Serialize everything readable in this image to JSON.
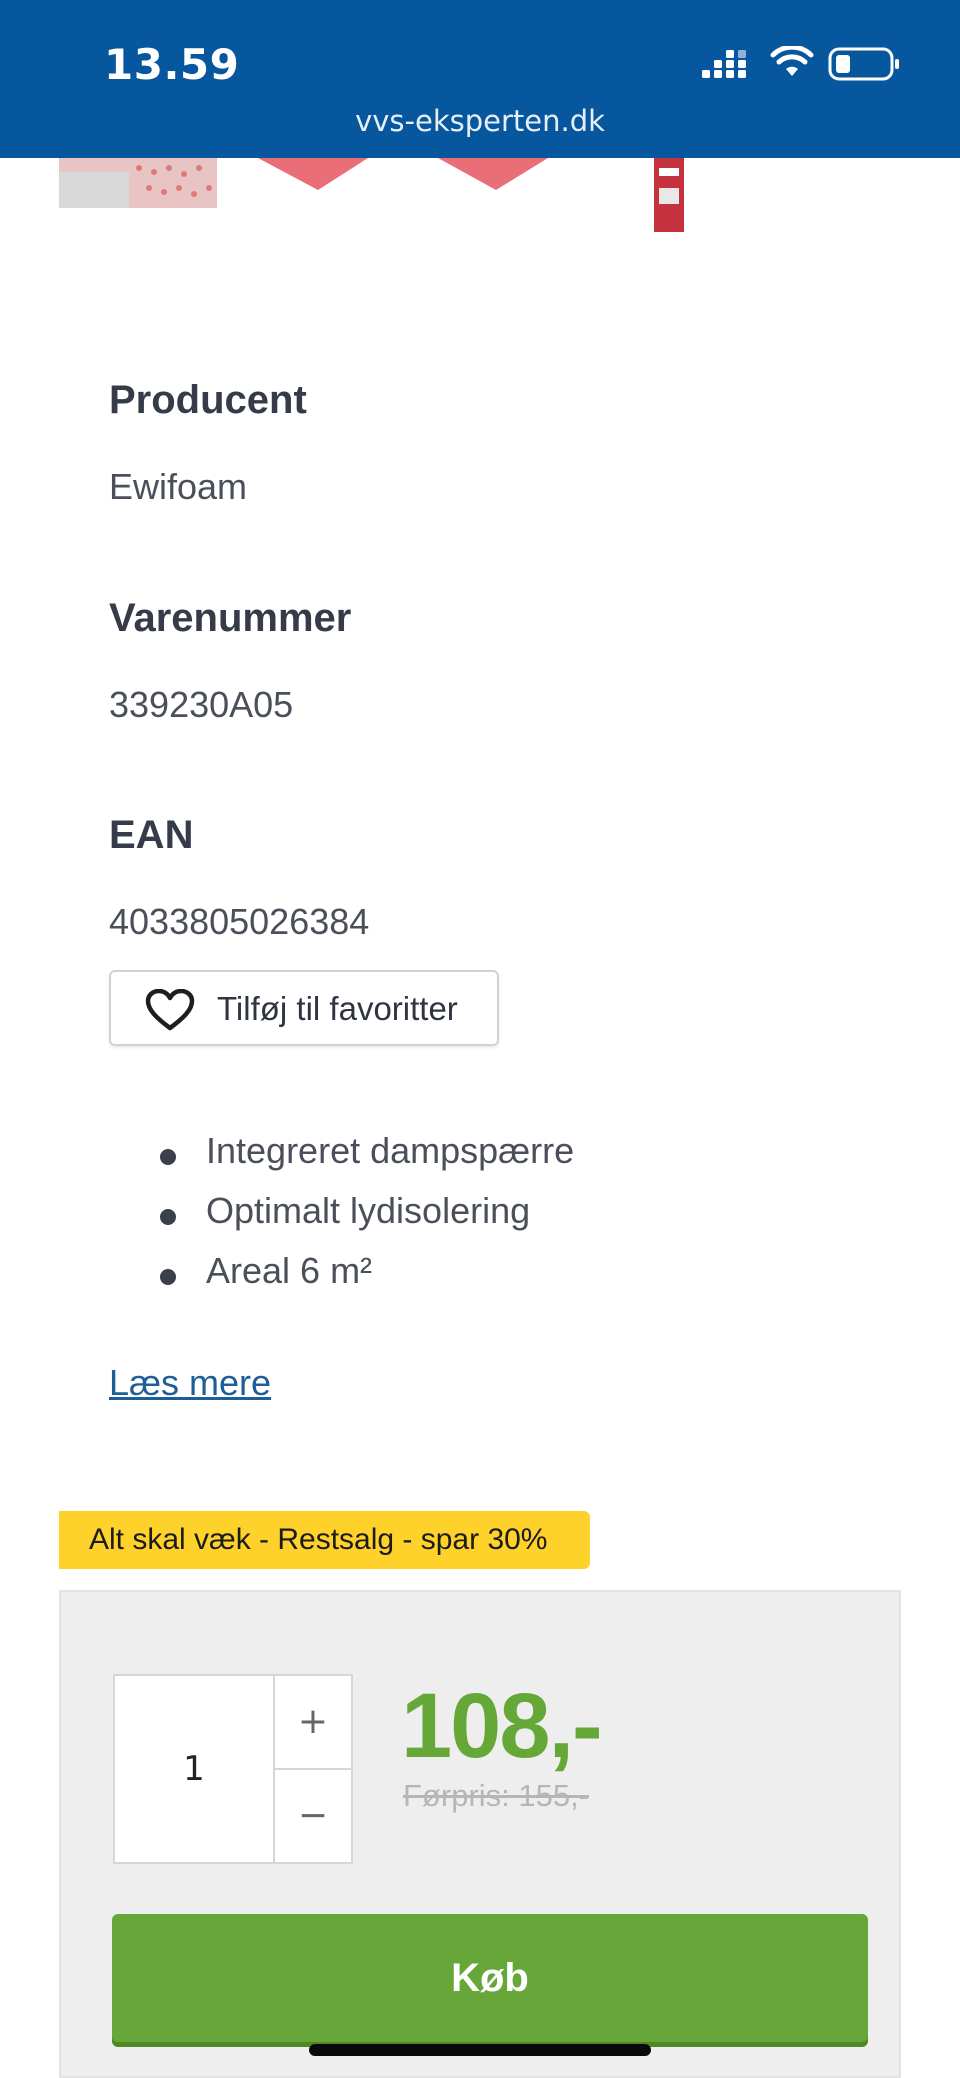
{
  "status_bar": {
    "time": "13.59",
    "url": "vvs-eksperten.dk"
  },
  "product_info": {
    "manufacturer_label": "Producent",
    "manufacturer_value": "Ewifoam",
    "item_number_label": "Varenummer",
    "item_number_value": "339230A05",
    "ean_label": "EAN",
    "ean_value": "4033805026384"
  },
  "favorite_button": {
    "label": "Tilføj til favoritter"
  },
  "features": [
    "Integreret dampspærre",
    "Optimalt lydisolering",
    "Areal 6 m²"
  ],
  "read_more": "Læs mere",
  "promo_badge": "Alt skal væk - Restsalg - spar 30%",
  "purchase": {
    "quantity": "1",
    "plus": "+",
    "minus": "−",
    "price": "108,-",
    "old_price": "Førpris: 155,-",
    "buy_label": "Køb"
  },
  "colors": {
    "header_blue": "#06579e",
    "price_green": "#66a838",
    "buy_green": "#67a639",
    "promo_yellow": "#fed22a",
    "link_blue": "#1f5d96"
  },
  "icons": [
    "signal-icon",
    "wifi-icon",
    "battery-icon",
    "heart-icon"
  ]
}
